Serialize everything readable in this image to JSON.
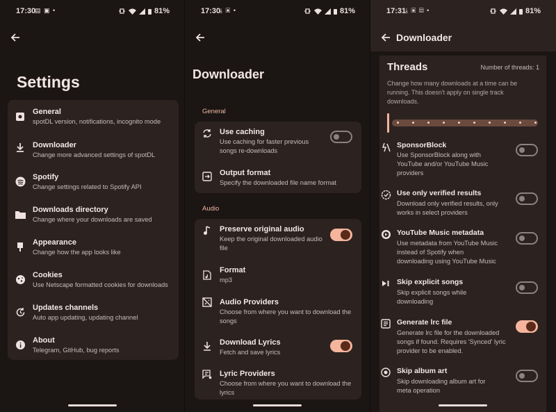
{
  "screen1": {
    "status": {
      "time": "17:30",
      "battery": "81%"
    },
    "title": "Settings",
    "items": [
      {
        "title": "General",
        "subtitle": "spotDL version, notifications, incognito mode"
      },
      {
        "title": "Downloader",
        "subtitle": "Change more advanced settings of spotDL"
      },
      {
        "title": "Spotify",
        "subtitle": "Change settings related to Spotify API"
      },
      {
        "title": "Downloads directory",
        "subtitle": "Change where your downloads are saved"
      },
      {
        "title": "Appearance",
        "subtitle": "Change how the app looks like"
      },
      {
        "title": "Cookies",
        "subtitle": "Use Netscape formatted cookies for downloads"
      },
      {
        "title": "Updates channels",
        "subtitle": "Auto app updating, updating channel"
      },
      {
        "title": "About",
        "subtitle": "Telegram, GitHub, bug reports"
      }
    ]
  },
  "screen2": {
    "status": {
      "time": "17:30",
      "battery": "81%"
    },
    "title": "Downloader",
    "general_label": "General",
    "general_items": [
      {
        "title": "Use caching",
        "subtitle": "Use caching for faster previous songs re-downloads",
        "toggle": "off"
      },
      {
        "title": "Output format",
        "subtitle": "Specify the downloaded file name format"
      }
    ],
    "audio_label": "Audio",
    "audio_items": [
      {
        "title": "Preserve original audio",
        "subtitle": "Keep the original downloaded audio file",
        "toggle": "on"
      },
      {
        "title": "Format",
        "subtitle": "mp3"
      },
      {
        "title": "Audio Providers",
        "subtitle": "Choose from where you want to download the songs"
      },
      {
        "title": "Download Lyrics",
        "subtitle": "Fetch and save lyrics",
        "toggle": "on"
      },
      {
        "title": "Lyric Providers",
        "subtitle": "Choose from where you want to download the lyrics"
      }
    ]
  },
  "screen3": {
    "status": {
      "time": "17:31",
      "battery": "81%"
    },
    "title": "Downloader",
    "threads": {
      "title": "Threads",
      "count_label": "Number of threads: 1",
      "description": "Change how many downloads at a time can be running. This doesn't apply on single track downloads.",
      "value": 1,
      "min": 1,
      "max": 10
    },
    "items": [
      {
        "title": "SponsorBlock",
        "subtitle": "Use SponsorBlock along with YouTube and/or YouTube Music providers",
        "toggle": "off"
      },
      {
        "title": "Use only verified results",
        "subtitle": "Download only verified results, only works in select providers",
        "toggle": "off"
      },
      {
        "title": "YouTube Music metadata",
        "subtitle": "Use metadata from YouTube Music instead of Spotify when downloading using YouTube Music",
        "toggle": "off"
      },
      {
        "title": "Skip explicit songs",
        "subtitle": "Skip explicit songs while downloading",
        "toggle": "off"
      },
      {
        "title": "Generate lrc file",
        "subtitle": "Generate lrc file for the downloaded songs if found. Requires 'Synced' lyric provider to be enabled.",
        "toggle": "on"
      },
      {
        "title": "Skip album art",
        "subtitle": "Skip downloading album art for meta operation",
        "toggle": "off"
      }
    ]
  },
  "colors": {
    "accent": "#f5b59d",
    "surface": "#2c2321",
    "background": "#1b1514",
    "section": "#f0b9a3"
  },
  "icons": [
    "arrow-back-icon",
    "general-icon",
    "download-icon",
    "spotify-icon",
    "folder-icon",
    "palette-icon",
    "cookie-icon",
    "update-icon",
    "info-icon",
    "sync-icon",
    "output-icon",
    "music-note-icon",
    "audio-file-icon",
    "providers-icon",
    "lyrics-icon",
    "sponsorblock-icon",
    "verified-icon",
    "youtube-music-icon",
    "skip-icon",
    "lrc-icon",
    "album-icon"
  ]
}
